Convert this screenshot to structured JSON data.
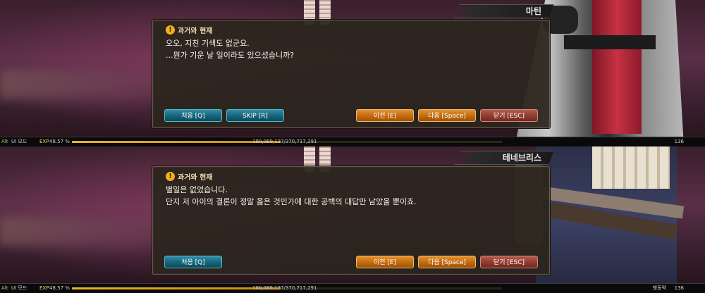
{
  "panels": [
    {
      "speaker": "마틴",
      "title": "과거와 현재",
      "lines": [
        "오오, 지친 기색도 없군요.",
        "...뭔가 기운 날 일이라도 있으셨습니까?"
      ],
      "buttons": {
        "first": "처음 [Q]",
        "skip": "SKIP [R]",
        "prev": "이전 [E]",
        "next": "다음 [Space]",
        "close": "닫기 [ESC]"
      },
      "hud": {
        "alt": "Alt",
        "ui_mode": "UI 모드",
        "exp_label": "EXP",
        "exp_percent": "48.57 %",
        "exp_fraction": 0.4857,
        "exp_value": "180,089,137/370,717,291",
        "level": "136",
        "extra": ""
      }
    },
    {
      "speaker": "테네브리스",
      "title": "과거와 현재",
      "lines": [
        "별일은 없었습니다.",
        "단지 저 아이의 결론이 정말 옳은 것인가에 대한 공백의 대답만 남았을 뿐이죠."
      ],
      "buttons": {
        "first": "처음 [Q]",
        "prev": "이전 [E]",
        "next": "다음 [Space]",
        "close": "닫기 [ESC]"
      },
      "hud": {
        "alt": "Alt",
        "ui_mode": "UI 모드",
        "exp_label": "EXP",
        "exp_percent": "48.57 %",
        "exp_fraction": 0.4857,
        "exp_value": "180,089,137/370,717,291",
        "level": "136",
        "extra": "행동력"
      }
    }
  ],
  "colors": {
    "quest_icon": "#f2b11a",
    "btn_blue": "#166478",
    "btn_orange": "#c26a10",
    "btn_red": "#8f3b30",
    "exp_bar": "#e8b42a"
  },
  "icons": {
    "quest": "exclamation-circle-icon"
  }
}
